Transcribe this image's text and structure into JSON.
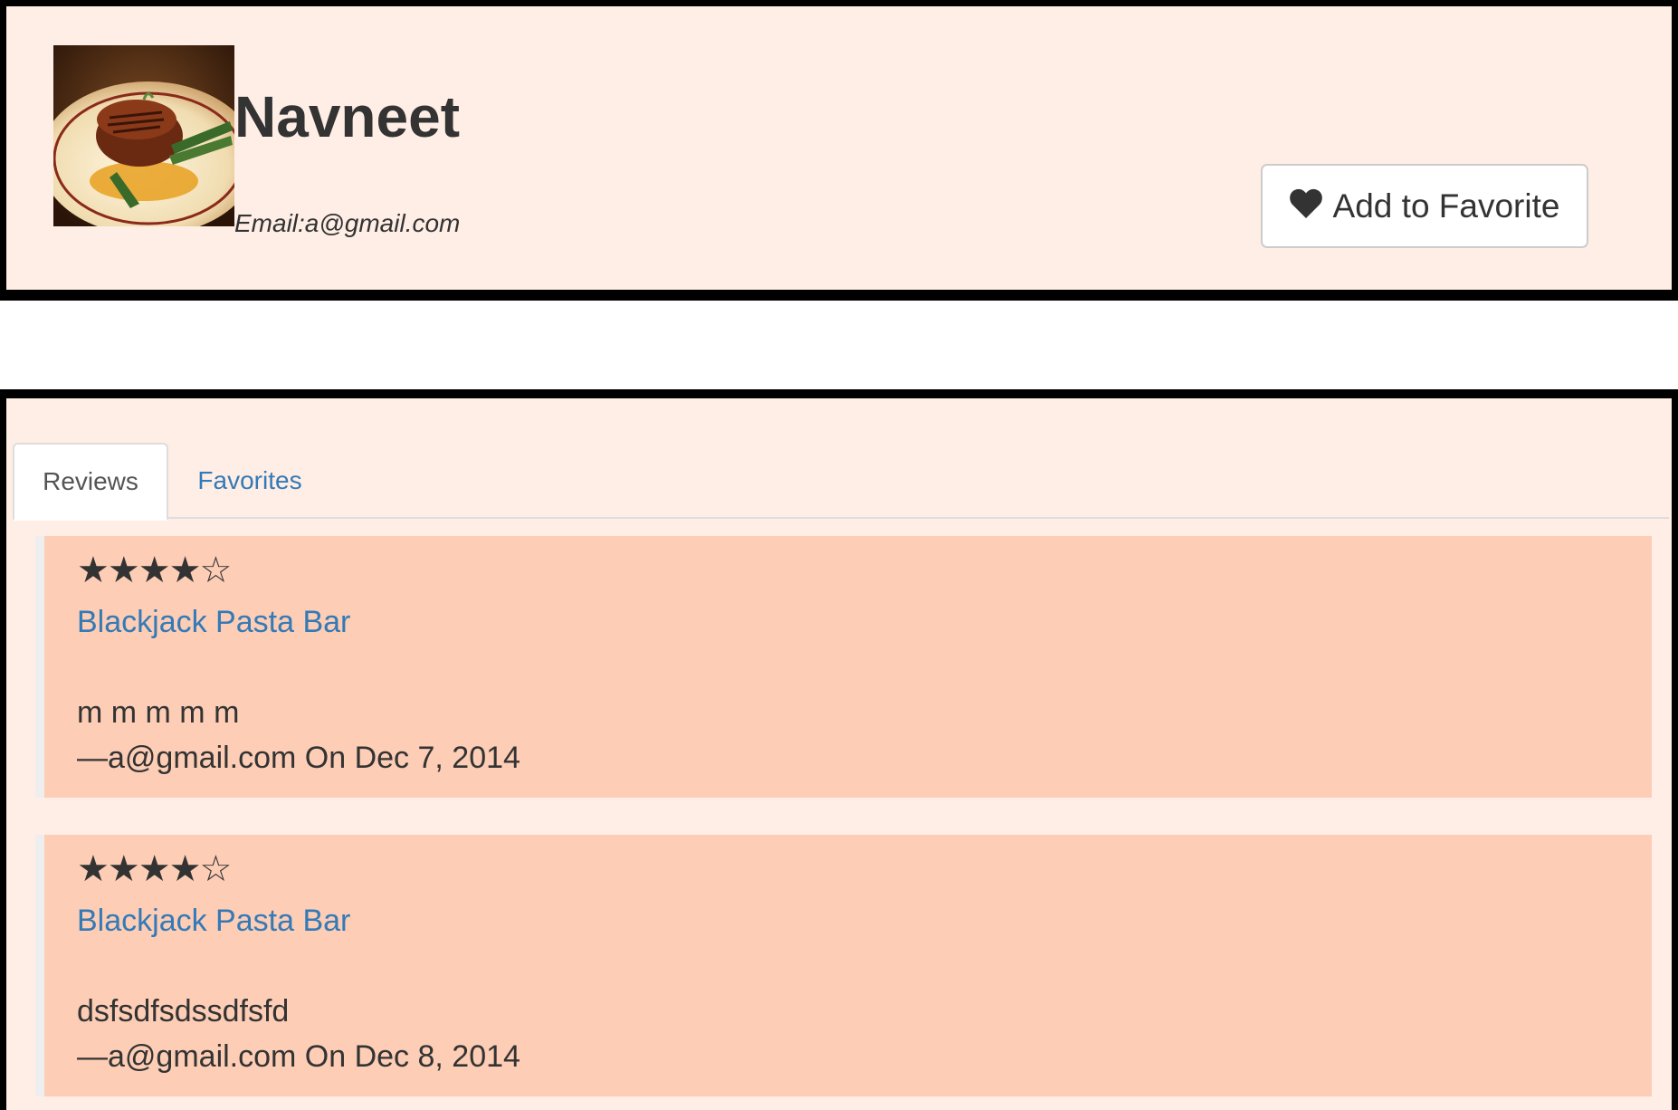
{
  "profile": {
    "name": "Navneet",
    "email_text": "Email:a@gmail.com",
    "photo_icon": "steak-dish-photo",
    "favorite_button_label": "Add to Favorite",
    "favorite_icon": "heart-icon"
  },
  "tabs": [
    {
      "label": "Reviews",
      "active": true
    },
    {
      "label": "Favorites",
      "active": false
    }
  ],
  "reviews": [
    {
      "stars": "★★★★☆",
      "rating": 4,
      "max_rating": 5,
      "restaurant": "Blackjack Pasta Bar",
      "text": "m m m m m",
      "footer": "—a@gmail.com On Dec 7, 2014"
    },
    {
      "stars": "★★★★☆",
      "rating": 4,
      "max_rating": 5,
      "restaurant": "Blackjack Pasta Bar",
      "text": "dsfsdfsdssdfsfd",
      "footer": "—a@gmail.com On Dec 8, 2014"
    }
  ],
  "colors": {
    "panel_background": "#ffeee6",
    "review_background": "#fdcdb5",
    "link": "#337ab7",
    "border": "#000000"
  }
}
